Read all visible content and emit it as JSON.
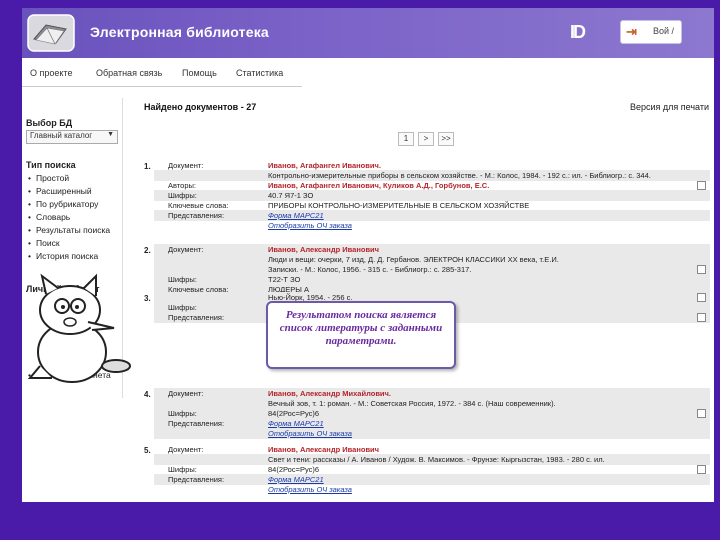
{
  "header": {
    "title": "Электронная библиотека",
    "exit_mark": "ID",
    "login_label": "Вой /"
  },
  "tabs": [
    "О проекте",
    "Обратная связь",
    "Помощь",
    "Статистика"
  ],
  "sidebar": {
    "db_title": "Выбор БД",
    "db_selected": "Главный каталог",
    "search_title": "Тип поиска",
    "search_items": [
      "Простой",
      "Расширенный",
      "По рубрикатору",
      "Словарь",
      "Результаты поиска",
      "Поиск",
      "История поиска"
    ],
    "cabinet_title": "Личный кабинет",
    "cabinet_item": "Выход из кабинета"
  },
  "results": {
    "found": "Найдено документов - 27",
    "print_link": "Версия для печати",
    "pages": [
      "1",
      ">",
      ">>"
    ]
  },
  "documents": [
    {
      "num": "1.",
      "rows": [
        {
          "k": "Документ:",
          "v": "Иванов, Агафангел Иванович.",
          "type": "author"
        },
        {
          "k": "",
          "v": "Контрольно-измерительные приборы в сельском хозяйстве. - М.: Колос, 1984. - 192 с.: ил. - Библиогр.: с. 344.",
          "type": "text"
        },
        {
          "k": "Авторы:",
          "v": "Иванов, Агафангел Иванович, Куликов А.Д., Горбунов, Е.С.",
          "type": "author"
        },
        {
          "k": "Шифры:",
          "v": "40.7 Я7-1 ЗО",
          "type": "text"
        },
        {
          "k": "Ключевые слова:",
          "v": "ПРИБОРЫ КОНТРОЛЬНО-ИЗМЕРИТЕЛЬНЫЕ В СЕЛЬСКОМ ХОЗЯЙСТВЕ",
          "type": "text"
        },
        {
          "k": "Представления:",
          "v": "Форма МАРС21",
          "type": "link"
        },
        {
          "k": "",
          "v": "Отобразить ОЧ заказа",
          "type": "link"
        }
      ]
    },
    {
      "num": "2.",
      "rows": [
        {
          "k": "Документ:",
          "v": "Иванов, Александр Иванович",
          "type": "author"
        },
        {
          "k": "",
          "v": "Люди и вещи: очерки, 7 изд, Д. Д. Гербанов. ЭЛЕКТРОН КЛАССИКИ XX века, т.Е.И.",
          "type": "text"
        },
        {
          "k": "",
          "v": "Записки. - М.: Колос, 1956. - 315 с. - Библиогр.: с. 285-317.",
          "type": "text"
        },
        {
          "k": "Шифры:",
          "v": "Т22-Т ЗО",
          "type": "text"
        },
        {
          "k": "Ключевые слова:",
          "v": "ЛЮДЕРЫ А",
          "type": "text"
        },
        {
          "k": "Представления:",
          "v": "Форма МАРС21",
          "type": "link"
        }
      ]
    },
    {
      "num": "3.",
      "rows": [
        {
          "k": "",
          "v": "Нью-Йорк, 1954. - 256 с.",
          "type": "text"
        },
        {
          "k": "Шифры:",
          "v": "",
          "type": "text"
        },
        {
          "k": "Представления:",
          "v": "",
          "type": "text"
        }
      ]
    },
    {
      "num": "4.",
      "rows": [
        {
          "k": "Документ:",
          "v": "Иванов, Александр Михайлович.",
          "type": "author"
        },
        {
          "k": "",
          "v": "Вечный зов, т. 1: роман. - М.: Советская Россия, 1972. - 384 с. (Наш современник).",
          "type": "text"
        },
        {
          "k": "Шифры:",
          "v": "84(2Рос=Рус)6",
          "type": "text"
        },
        {
          "k": "Представления:",
          "v": "Форма МАРС21",
          "type": "link"
        },
        {
          "k": "",
          "v": "Отобразить ОЧ заказа",
          "type": "link"
        }
      ]
    },
    {
      "num": "5.",
      "rows": [
        {
          "k": "Документ:",
          "v": "Иванов, Александр Иванович",
          "type": "author"
        },
        {
          "k": "",
          "v": "Свет и тени: рассказы / А. Иванов / Худож. В. Максимов. - Фрунзе: Кыргызстан, 1983. - 280 с. ил.",
          "type": "text"
        },
        {
          "k": "Шифры:",
          "v": "84(2Рос=Рус)6",
          "type": "text"
        },
        {
          "k": "Представления:",
          "v": "Форма МАРС21",
          "type": "link"
        },
        {
          "k": "",
          "v": "Отобразить ОЧ заказа",
          "type": "link"
        }
      ]
    }
  ],
  "callout": {
    "text": "Результатом поиска является список литературы с заданными параметрами."
  }
}
